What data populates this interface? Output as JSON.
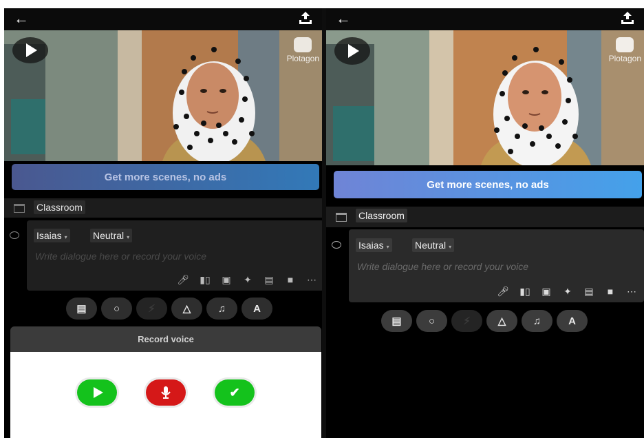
{
  "screens": [
    {
      "nav": {
        "back_icon": "arrow-left-icon",
        "share_icon": "share-upload-icon"
      },
      "scene": {
        "logo_text": "Plotagon",
        "play_icon": "play-icon"
      },
      "promo_label": "Get more scenes, no ads",
      "location": {
        "icon": "clapperboard-icon",
        "label": "Classroom"
      },
      "dialogue": {
        "character": "Isaias",
        "mood": "Neutral",
        "caret": "▾",
        "placeholder": "Write dialogue here or record your voice",
        "tools": [
          "microphone-icon",
          "chart-icon",
          "image-icon",
          "sparkle-icon",
          "landscape-icon",
          "video-icon",
          "more-icon"
        ]
      },
      "bottom_buttons": [
        "scene-icon",
        "dialogue-icon",
        "action-icon",
        "sound-effect-icon",
        "music-icon",
        "text-icon"
      ],
      "record_sheet": {
        "title": "Record voice",
        "buttons": [
          {
            "icon": "play-icon",
            "color": "#14c21c"
          },
          {
            "icon": "microphone-icon",
            "color": "#d51818"
          },
          {
            "icon": "check-icon",
            "color": "#14c21c"
          }
        ]
      }
    },
    {
      "nav": {
        "back_icon": "arrow-left-icon",
        "share_icon": "share-upload-icon"
      },
      "scene": {
        "logo_text": "Plotagon",
        "play_icon": "play-icon"
      },
      "promo_label": "Get more scenes, no ads",
      "location": {
        "icon": "clapperboard-icon",
        "label": "Classroom"
      },
      "dialogue": {
        "character": "Isaias",
        "mood": "Neutral",
        "caret": "▾",
        "placeholder": "Write dialogue here or record your voice",
        "tools": [
          "microphone-icon",
          "chart-icon",
          "image-icon",
          "sparkle-icon",
          "landscape-icon",
          "video-icon",
          "more-icon"
        ]
      },
      "bottom_buttons": [
        "scene-icon",
        "dialogue-icon",
        "action-icon",
        "sound-effect-icon",
        "music-icon",
        "text-icon"
      ]
    }
  ],
  "colors": {
    "promo_gradient_start": "#6f84d6",
    "promo_gradient_end": "#44a1ea",
    "record_green": "#14c21c",
    "record_red": "#d51818"
  }
}
